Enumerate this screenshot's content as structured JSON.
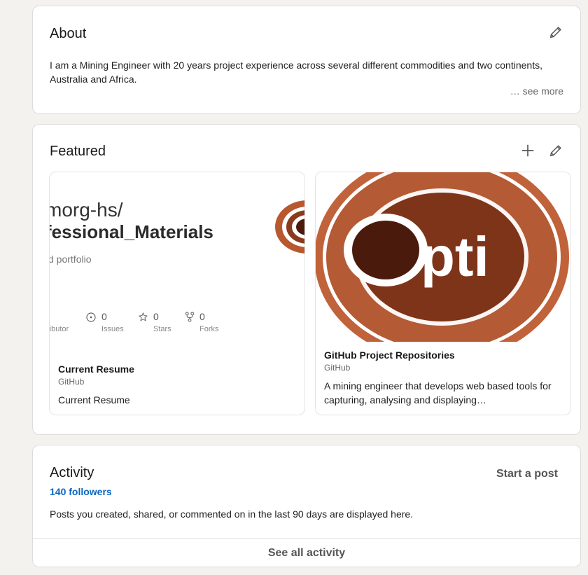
{
  "about": {
    "title": "About",
    "text": "I am a Mining Engineer with 20 years project experience across several different commodities and two continents, Australia and Africa.",
    "see_more": "… see more",
    "edit_icon": "pencil-icon"
  },
  "featured": {
    "title": "Featured",
    "add_icon": "plus-icon",
    "edit_icon": "pencil-icon",
    "items": [
      {
        "thumb": {
          "repo_owner": "morg-hs/",
          "repo_name": "fessional_Materials",
          "repo_desc": "d portfolio",
          "stats": [
            {
              "label": "ributor",
              "value": ""
            },
            {
              "label": "Issues",
              "value": "0"
            },
            {
              "label": "Stars",
              "value": "0"
            },
            {
              "label": "Forks",
              "value": "0"
            }
          ]
        },
        "title": "Current Resume",
        "source": "GitHub",
        "description": "Current Resume"
      },
      {
        "thumb": {
          "logo_text": "pti"
        },
        "title": "GitHub Project Repositories",
        "source": "GitHub",
        "description": "A mining engineer that develops web based tools for capturing, analysing and displaying…"
      }
    ]
  },
  "activity": {
    "title": "Activity",
    "followers": "140 followers",
    "start_post": "Start a post",
    "info": "Posts you created, shared, or commented on in the last 90 days are displayed here.",
    "see_all": "See all activity"
  },
  "colors": {
    "link_blue": "#0a66c2",
    "opti_orange": "#c0623a",
    "opti_dark": "#4a1a0c"
  }
}
